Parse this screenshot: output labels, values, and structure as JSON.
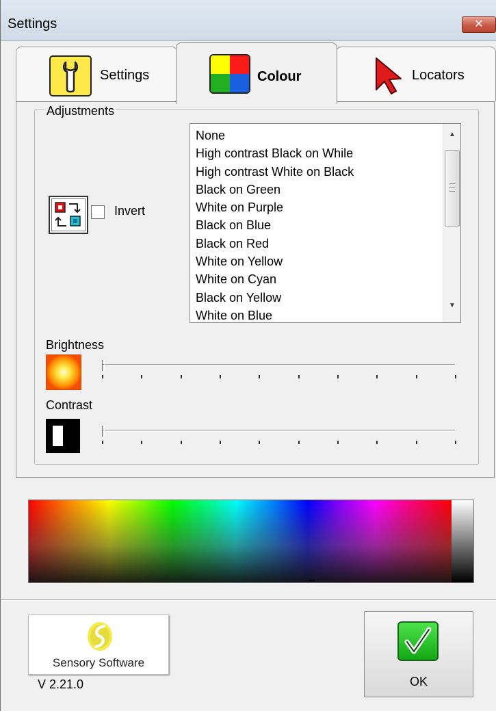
{
  "window": {
    "title": "Settings",
    "close_label": "✕"
  },
  "tabs": [
    {
      "label": "Settings",
      "icon": "wrench-icon",
      "selected": false
    },
    {
      "label": "Colour",
      "icon": "colour-quadrant-icon",
      "selected": true
    },
    {
      "label": "Locators",
      "icon": "cursor-arrow-icon",
      "selected": false
    }
  ],
  "adjustments": {
    "legend": "Adjustments",
    "invert": {
      "label": "Invert",
      "checked": false
    },
    "colour_schemes": [
      "None",
      "High contrast Black on While",
      "High contrast White on Black",
      "Black on Green",
      "White on Purple",
      "Black on Blue",
      "Black on Red",
      "White on Yellow",
      "White on Cyan",
      "Black on Yellow",
      "White on Blue"
    ],
    "brightness": {
      "label": "Brightness",
      "value": 0,
      "ticks": 10
    },
    "contrast": {
      "label": "Contrast",
      "value": 0,
      "ticks": 10
    }
  },
  "footer": {
    "logo_text": "Sensory Software",
    "version": "V 2.21.0",
    "ok_label": "OK"
  },
  "colors": {
    "accent_yellow": "#ffe94a",
    "ok_green": "#22c022",
    "close_red": "#c75a47"
  }
}
